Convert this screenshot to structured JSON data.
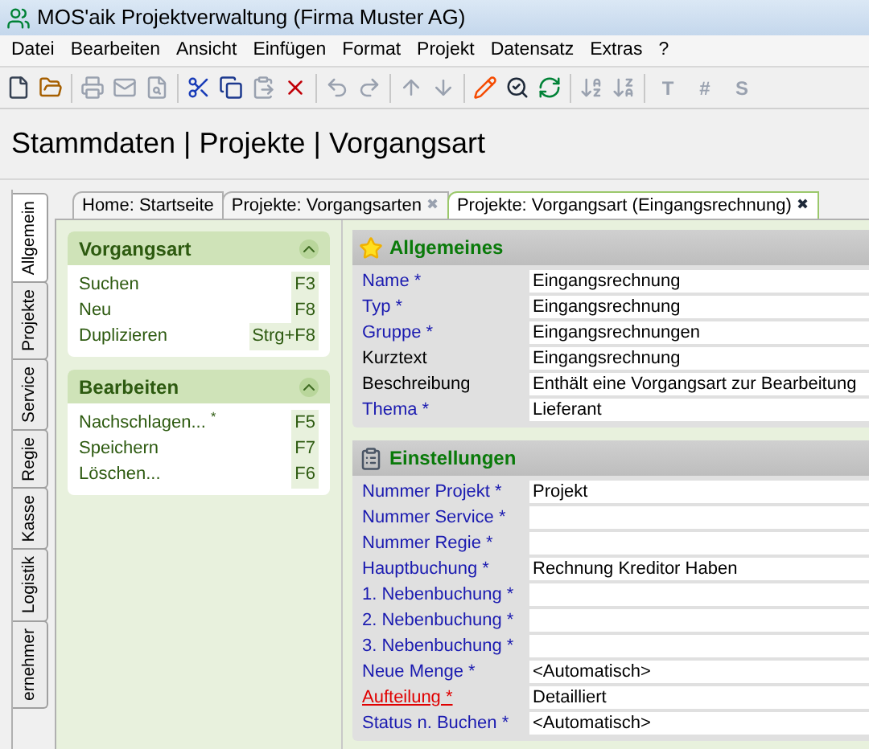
{
  "window": {
    "title": "MOS'aik Projektverwaltung (Firma Muster AG)"
  },
  "menu": [
    "Datei",
    "Bearbeiten",
    "Ansicht",
    "Einfügen",
    "Format",
    "Projekt",
    "Datensatz",
    "Extras",
    "?"
  ],
  "toolbar": [
    {
      "kind": "icon",
      "disabled": false
    },
    {
      "kind": "icon",
      "disabled": false
    },
    {
      "kind": "separator"
    },
    {
      "kind": "icon",
      "disabled": true
    },
    {
      "kind": "icon",
      "disabled": true
    },
    {
      "kind": "icon",
      "disabled": true
    },
    {
      "kind": "separator"
    },
    {
      "kind": "icon",
      "disabled": false
    },
    {
      "kind": "icon",
      "disabled": false
    },
    {
      "kind": "icon",
      "disabled": true
    },
    {
      "kind": "icon",
      "disabled": false
    },
    {
      "kind": "separator"
    },
    {
      "kind": "icon",
      "disabled": true
    },
    {
      "kind": "icon",
      "disabled": true
    },
    {
      "kind": "separator"
    },
    {
      "kind": "icon",
      "disabled": true
    },
    {
      "kind": "icon",
      "disabled": true
    },
    {
      "kind": "separator"
    },
    {
      "kind": "icon",
      "disabled": false
    },
    {
      "kind": "icon",
      "disabled": false
    },
    {
      "kind": "icon",
      "disabled": false
    },
    {
      "kind": "separator"
    },
    {
      "kind": "icon",
      "disabled": true
    },
    {
      "kind": "icon",
      "disabled": true
    },
    {
      "kind": "separator"
    },
    {
      "kind": "text",
      "label": "T",
      "disabled": true
    },
    {
      "kind": "text",
      "label": "#",
      "disabled": true
    },
    {
      "kind": "text",
      "label": "S",
      "disabled": true
    }
  ],
  "breadcrumb": "Stammdaten | Projekte | Vorgangsart",
  "side_tabs": [
    {
      "label": "Allgemein",
      "selected": true
    },
    {
      "label": "Projekte",
      "selected": false
    },
    {
      "label": "Service",
      "selected": false
    },
    {
      "label": "Regie",
      "selected": false
    },
    {
      "label": "Kasse",
      "selected": false
    },
    {
      "label": "Logistik",
      "selected": false
    },
    {
      "label": "ernehmer",
      "selected": false
    }
  ],
  "doc_tabs": [
    {
      "label": "Home: Startseite",
      "closable": false,
      "selected": false
    },
    {
      "label": "Projekte: Vorgangsarten",
      "closable": true,
      "selected": false
    },
    {
      "label": "Projekte: Vorgangsart (Eingangsrechnung)",
      "closable": true,
      "selected": true
    }
  ],
  "close_glyph": "✖",
  "task_panels": [
    {
      "title": "Vorgangsart",
      "items": [
        {
          "label": "Suchen",
          "shortcut": "F3"
        },
        {
          "label": "Neu",
          "shortcut": "F8"
        },
        {
          "label": "Duplizieren",
          "shortcut": "Strg+F8"
        }
      ]
    },
    {
      "title": "Bearbeiten",
      "items": [
        {
          "label": "Nachschlagen... $^{*}$",
          "shortcut": "F5"
        },
        {
          "label": "Speichern",
          "shortcut": "F7"
        },
        {
          "label": "Löschen...",
          "shortcut": "F6"
        }
      ]
    }
  ],
  "sections": [
    {
      "title": "Allgemeines",
      "fields": [
        {
          "label": "Name *",
          "kind": "required",
          "value": "Eingangsrechnung"
        },
        {
          "label": "Typ *",
          "kind": "required",
          "value": "Eingangsrechnung"
        },
        {
          "label": "Gruppe *",
          "kind": "required",
          "value": "Eingangsrechnungen"
        },
        {
          "label": "Kurztext",
          "kind": "optional",
          "value": "Eingangsrechnung"
        },
        {
          "label": "Beschreibung",
          "kind": "optional",
          "value": "Enthält eine Vorgangsart zur Bearbeitung"
        },
        {
          "label": "Thema *",
          "kind": "required",
          "value": "Lieferant"
        }
      ]
    },
    {
      "title": "Einstellungen",
      "fields": [
        {
          "label": "Nummer Projekt *",
          "kind": "required",
          "value": "Projekt"
        },
        {
          "label": "Nummer Service *",
          "kind": "required"
        },
        {
          "label": "Nummer Regie *",
          "kind": "required"
        },
        {
          "label": "Hauptbuchung *",
          "kind": "required",
          "value": "Rechnung Kreditor Haben"
        },
        {
          "label": "1. Nebenbuchung *",
          "kind": "required"
        },
        {
          "label": "2. Nebenbuchung *",
          "kind": "required"
        },
        {
          "label": "3. Nebenbuchung *",
          "kind": "required"
        },
        {
          "label": "Neue Menge *",
          "kind": "required",
          "value": "<Automatisch>"
        },
        {
          "label": "Aufteilung *",
          "kind": "error",
          "value": "Detailliert"
        },
        {
          "label": "Status n. Buchen *",
          "kind": "required",
          "value": "<Automatisch>"
        }
      ]
    }
  ]
}
